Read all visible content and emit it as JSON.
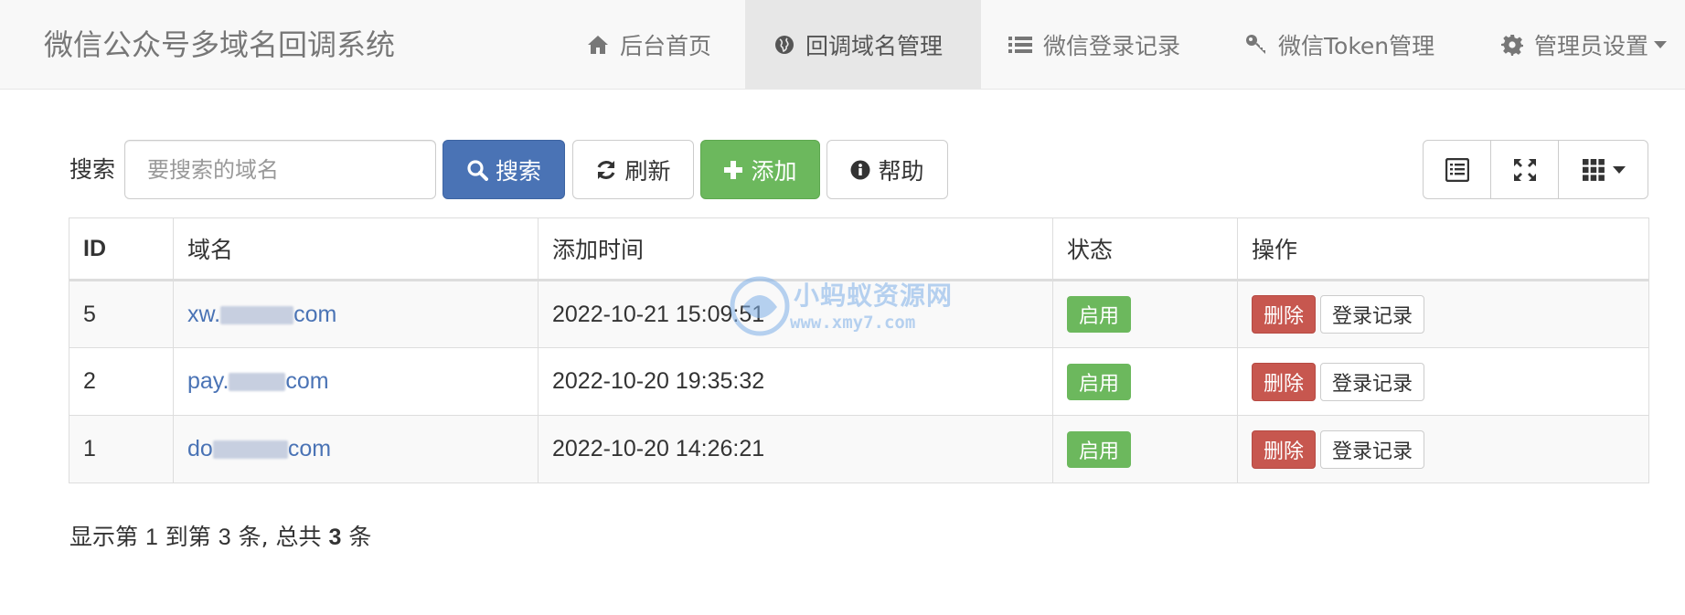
{
  "navbar": {
    "brand": "微信公众号多域名回调系统",
    "items": [
      {
        "label": "后台首页",
        "icon": "home-icon"
      },
      {
        "label": "回调域名管理",
        "icon": "globe-icon",
        "active": true
      },
      {
        "label": "微信登录记录",
        "icon": "list-icon"
      },
      {
        "label": "微信Token管理",
        "icon": "key-icon"
      },
      {
        "label": "管理员设置",
        "icon": "gear-icon",
        "dropdown": true
      }
    ]
  },
  "toolbar": {
    "search_label": "搜索",
    "search_placeholder": "要搜索的域名",
    "search_button": "搜索",
    "refresh_button": "刷新",
    "add_button": "添加",
    "help_button": "帮助"
  },
  "table": {
    "headers": [
      "ID",
      "域名",
      "添加时间",
      "状态",
      "操作"
    ],
    "rows": [
      {
        "id": "5",
        "domain_prefix": "xw.",
        "domain_suffix": "com",
        "time": "2022-10-21 15:09:51",
        "status": "启用",
        "delete": "删除",
        "log": "登录记录"
      },
      {
        "id": "2",
        "domain_prefix": "pay.",
        "domain_suffix": "com",
        "time": "2022-10-20 19:35:32",
        "status": "启用",
        "delete": "删除",
        "log": "登录记录"
      },
      {
        "id": "1",
        "domain_prefix": "do",
        "domain_suffix": "com",
        "time": "2022-10-20 14:26:21",
        "status": "启用",
        "delete": "删除",
        "log": "登录记录"
      }
    ]
  },
  "footer": {
    "p1": "显示第 ",
    "from": "1",
    "p2": " 到第 ",
    "to": "3",
    "p3": " 条, 总共 ",
    "total": "3",
    "p4": " 条"
  },
  "watermark": {
    "title": "小蚂蚁资源网",
    "url": "www.xmy7.com"
  },
  "colors": {
    "primary": "#4a73b5",
    "success": "#6cb85d",
    "danger": "#c7574f",
    "navbar_bg": "#f8f8f8"
  }
}
